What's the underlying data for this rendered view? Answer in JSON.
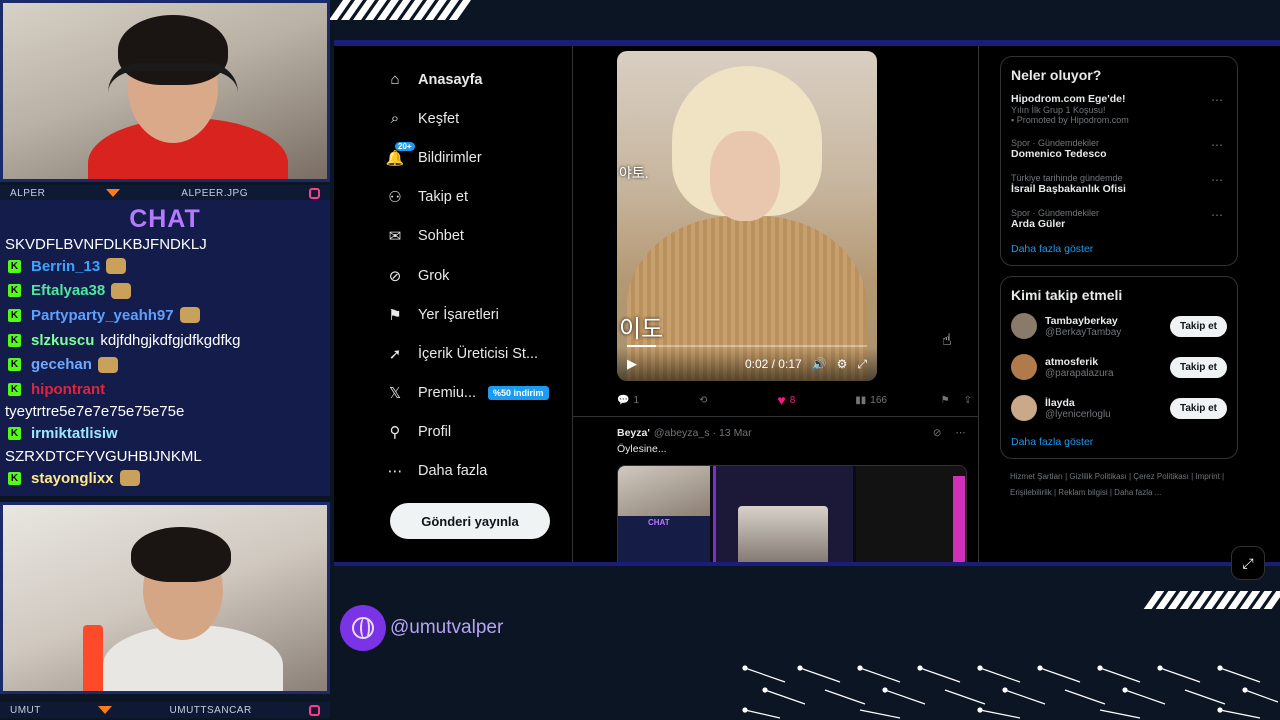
{
  "overlay": {
    "cam_top": {
      "left": "ALPER",
      "right": "ALPEER.JPG"
    },
    "cam_bottom": {
      "left": "UMUT",
      "right": "UMUTTSANCAR"
    },
    "chat_title": "CHAT",
    "chat_lines": [
      {
        "type": "plain",
        "text": "SKVDFLBVNFDLKBJFNDKLJ"
      },
      {
        "type": "user",
        "user": "Berrin_13",
        "color": "#3ea3ff",
        "msg": "",
        "emote": true
      },
      {
        "type": "user",
        "user": "Eftalyaa38",
        "color": "#4ee6a0",
        "msg": "",
        "emote": true
      },
      {
        "type": "user",
        "user": "Partyparty_yeahh97",
        "color": "#5fa0ff",
        "msg": "",
        "emote": true
      },
      {
        "type": "user",
        "user": "slzkuscu",
        "color": "#7dff9a",
        "msg": "kdjfdhgjkdfgjdfkgdfkg",
        "emote": false
      },
      {
        "type": "user",
        "user": "gecehan",
        "color": "#6ea9ff",
        "msg": "",
        "emote": true
      },
      {
        "type": "user",
        "user": "hipontrant",
        "color": "#e0243c",
        "msg": "",
        "emote": false
      },
      {
        "type": "plain",
        "text": "tyeytrtre5e7e7e75e75e75e"
      },
      {
        "type": "user",
        "user": "irmiktatlisiw",
        "color": "#9be7ff",
        "msg": "",
        "emote": false
      },
      {
        "type": "plain",
        "text": "SZRXDTCFYVGUHBIJNKML"
      },
      {
        "type": "user",
        "user": "stayonglixx",
        "color": "#ffe98a",
        "msg": "",
        "emote": true
      }
    ],
    "handle": "@umutvalper"
  },
  "nav": {
    "items": [
      {
        "label": "Anasayfa",
        "icon": "home-icon",
        "glyph": "⌂",
        "active": true
      },
      {
        "label": "Keşfet",
        "icon": "search-icon",
        "glyph": "⌕"
      },
      {
        "label": "Bildirimler",
        "icon": "bell-icon",
        "glyph": "🔔",
        "badge": "20+"
      },
      {
        "label": "Takip et",
        "icon": "add-person-icon",
        "glyph": "⚇"
      },
      {
        "label": "Sohbet",
        "icon": "mail-icon",
        "glyph": "✉"
      },
      {
        "label": "Grok",
        "icon": "grok-icon",
        "glyph": "⊘"
      },
      {
        "label": "Yer İşaretleri",
        "icon": "bookmark-icon",
        "glyph": "⚑"
      },
      {
        "label": "İçerik Üreticisi St...",
        "icon": "rocket-icon",
        "glyph": "➚"
      },
      {
        "label": "Premiu...",
        "icon": "x-logo-icon",
        "glyph": "𝕏",
        "promo": "%50 indirim"
      },
      {
        "label": "Profil",
        "icon": "person-icon",
        "glyph": "⚲"
      },
      {
        "label": "Daha fazla",
        "icon": "more-circle-icon",
        "glyph": "⋯"
      }
    ],
    "post_button": "Gönderi yayınla"
  },
  "video": {
    "subtitle_top": "야토.",
    "subtitle_bottom": "이도",
    "time": "0:02 / 0:17",
    "progress": 0.12
  },
  "actions": {
    "replies": "1",
    "reposts": "",
    "likes": "8",
    "views": "166"
  },
  "tweet2": {
    "name": "Beyza'",
    "handle": "@abeyza_s",
    "date": "13 Mar",
    "text": "Öylesine...",
    "media_chat": "CHAT"
  },
  "trends": {
    "title": "Neler oluyor?",
    "items": [
      {
        "context": "",
        "title": "Hipodrom.com Ege'de!",
        "sub": "Yılın İlk Grup 1 Koşusu!",
        "promo": "Promoted by Hipodrom.com"
      },
      {
        "context": "Spor · Gündemdekiler",
        "title": "Domenico Tedesco",
        "sub": "",
        "promo": ""
      },
      {
        "context": "Türkiye tarihinde gündemde",
        "title": "İsrail Başbakanlık Ofisi",
        "sub": "",
        "promo": ""
      },
      {
        "context": "Spor · Gündemdekiler",
        "title": "Arda Güler",
        "sub": "",
        "promo": ""
      }
    ],
    "more": "Daha fazla göster"
  },
  "who_to_follow": {
    "title": "Kimi takip etmeli",
    "items": [
      {
        "name": "Tambayberkay",
        "handle": "@BerkayTambay",
        "button": "Takip et",
        "color": "#8a7a6a"
      },
      {
        "name": "atmosferik",
        "handle": "@parapalazura",
        "button": "Takip et",
        "color": "#b07a4a"
      },
      {
        "name": "İlayda",
        "handle": "@lyenicerloglu",
        "button": "Takip et",
        "color": "#c9a98a"
      }
    ],
    "more": "Daha fazla göster"
  },
  "footer": "Hizmet Şartları  |  Gizlilik Politikası  |  Çerez Politikası  |  Imprint  |  Erişilebilirlik  |  Reklam bilgisi  |  Daha fazla ..."
}
